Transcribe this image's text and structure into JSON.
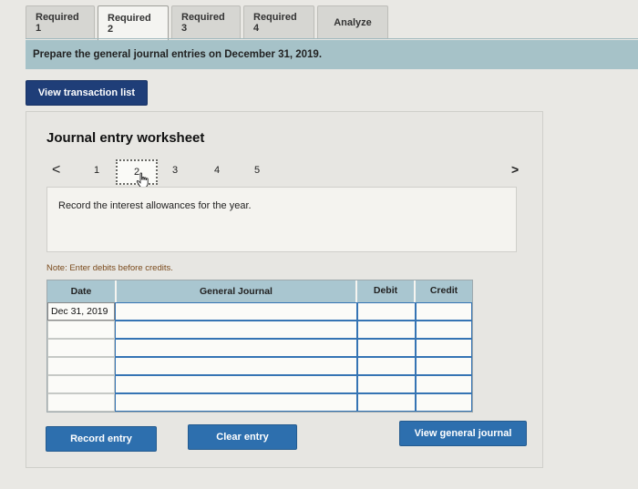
{
  "tabs": [
    {
      "label": "Required 1",
      "active": false
    },
    {
      "label": "Required 2",
      "active": true
    },
    {
      "label": "Required 3",
      "active": false
    },
    {
      "label": "Required 4",
      "active": false
    },
    {
      "label": "Analyze",
      "active": false
    }
  ],
  "banner": {
    "text": "Prepare the general journal entries on December 31, 2019."
  },
  "buttons": {
    "view_transactions": "View transaction list",
    "record_entry": "Record entry",
    "clear_entry": "Clear entry",
    "view_general_journal": "View general journal"
  },
  "worksheet": {
    "title": "Journal entry worksheet",
    "prev_glyph": "<",
    "next_glyph": ">",
    "pages": [
      "1",
      "2",
      "3",
      "4",
      "5"
    ],
    "current_page": "2",
    "instruction": "Record the interest allowances for the year.",
    "note": "Note: Enter debits before credits."
  },
  "journal": {
    "headers": {
      "date": "Date",
      "general_journal": "General Journal",
      "debit": "Debit",
      "credit": "Credit"
    },
    "rows": [
      {
        "date": "Dec 31, 2019",
        "account": "",
        "debit": "",
        "credit": ""
      },
      {
        "date": "",
        "account": "",
        "debit": "",
        "credit": ""
      },
      {
        "date": "",
        "account": "",
        "debit": "",
        "credit": ""
      },
      {
        "date": "",
        "account": "",
        "debit": "",
        "credit": ""
      },
      {
        "date": "",
        "account": "",
        "debit": "",
        "credit": ""
      },
      {
        "date": "",
        "account": "",
        "debit": "",
        "credit": ""
      }
    ]
  },
  "colors": {
    "banner": "#a6c2c8",
    "primary_button": "#2d6fae",
    "dark_button": "#1f3e78",
    "table_header": "#a9c6d0",
    "cell_border": "#3574b4"
  }
}
